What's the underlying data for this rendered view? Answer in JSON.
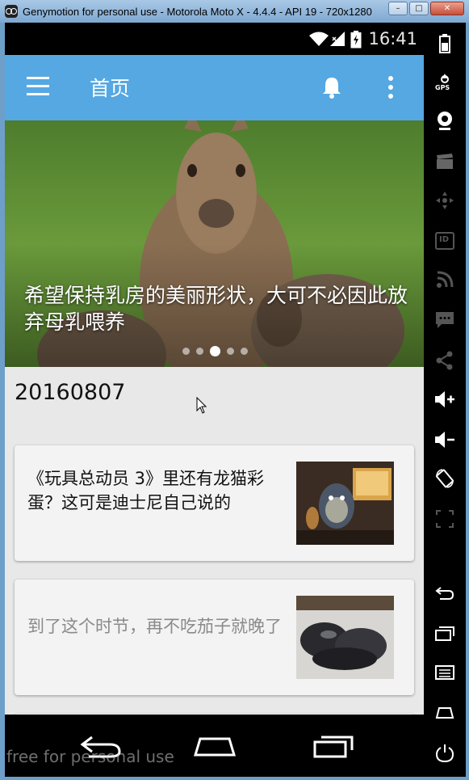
{
  "window": {
    "title": "Genymotion for personal use - Motorola Moto X - 4.4.4 - API 19 - 720x1280",
    "minimize_label": "–",
    "maximize_label": "□",
    "close_label": "✕"
  },
  "statusbar": {
    "time": "16:41"
  },
  "toolbar": {
    "title": "首页"
  },
  "banner": {
    "caption": "希望保持乳房的美丽形状，大可不必因此放弃母乳喂养",
    "dots_count": 5,
    "active_dot": 2
  },
  "feed": {
    "date": "20160807",
    "cards": [
      {
        "title": "《玩具总动员 3》里还有龙猫彩蛋？这可是迪士尼自己说的",
        "read": false
      },
      {
        "title": "到了这个时节，再不吃茄子就晚了",
        "read": true
      },
      {
        "title": "",
        "read": false
      }
    ]
  },
  "watermark": "free for personal use",
  "sidebar": {
    "icons": [
      "battery-icon",
      "gps-icon",
      "webcam-icon",
      "clapper-icon",
      "dpad-icon",
      "id-icon",
      "rss-icon",
      "sms-icon",
      "share-icon",
      "volume-up-icon",
      "volume-down-icon",
      "rotate-icon",
      "fullscreen-icon",
      "back-icon",
      "recents-icon",
      "menu-icon",
      "home-icon",
      "power-icon"
    ],
    "gps_label": "GPS",
    "id_label": "ID"
  },
  "colors": {
    "toolbar": "#55a8e2",
    "background": "#e8e8e8",
    "card": "#f3f3f3"
  }
}
